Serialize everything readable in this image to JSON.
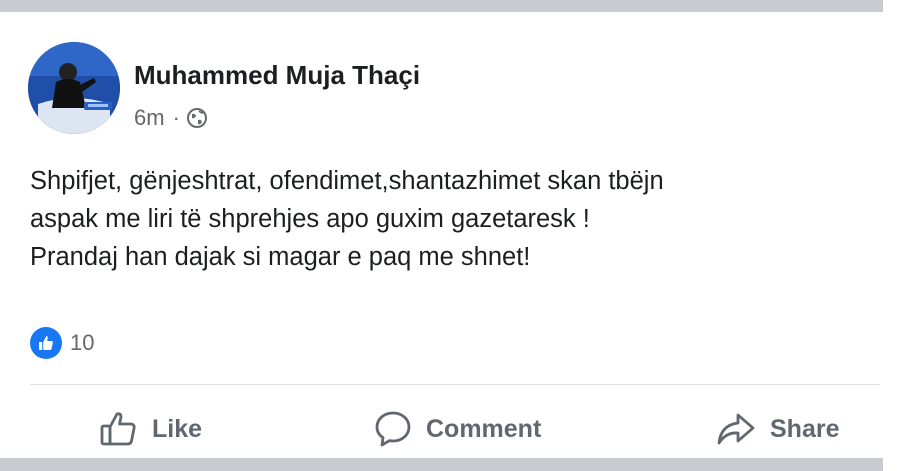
{
  "post": {
    "author": "Muhammed Muja Thaçi",
    "timestamp": "6m",
    "separator": "·",
    "audience_icon": "globe-icon",
    "text_lines": [
      "Shpifjet, gënjeshtrat, ofendimet,shantazhimet skan tbëjn",
      "aspak me liri të shprehjes apo guxim gazetaresk !",
      "Prandaj han dajak si magar e paq me shnet!"
    ],
    "reactions": {
      "icon": "thumbs-up-icon",
      "count": "10"
    },
    "actions": {
      "like": "Like",
      "comment": "Comment",
      "share": "Share"
    }
  },
  "colors": {
    "primary_text": "#1c1e21",
    "secondary_text": "#65676b",
    "action_text": "#606770",
    "like_blue": "#1877f2",
    "divider": "#dfe1e5",
    "frame_gray": "#c9cbd1"
  }
}
